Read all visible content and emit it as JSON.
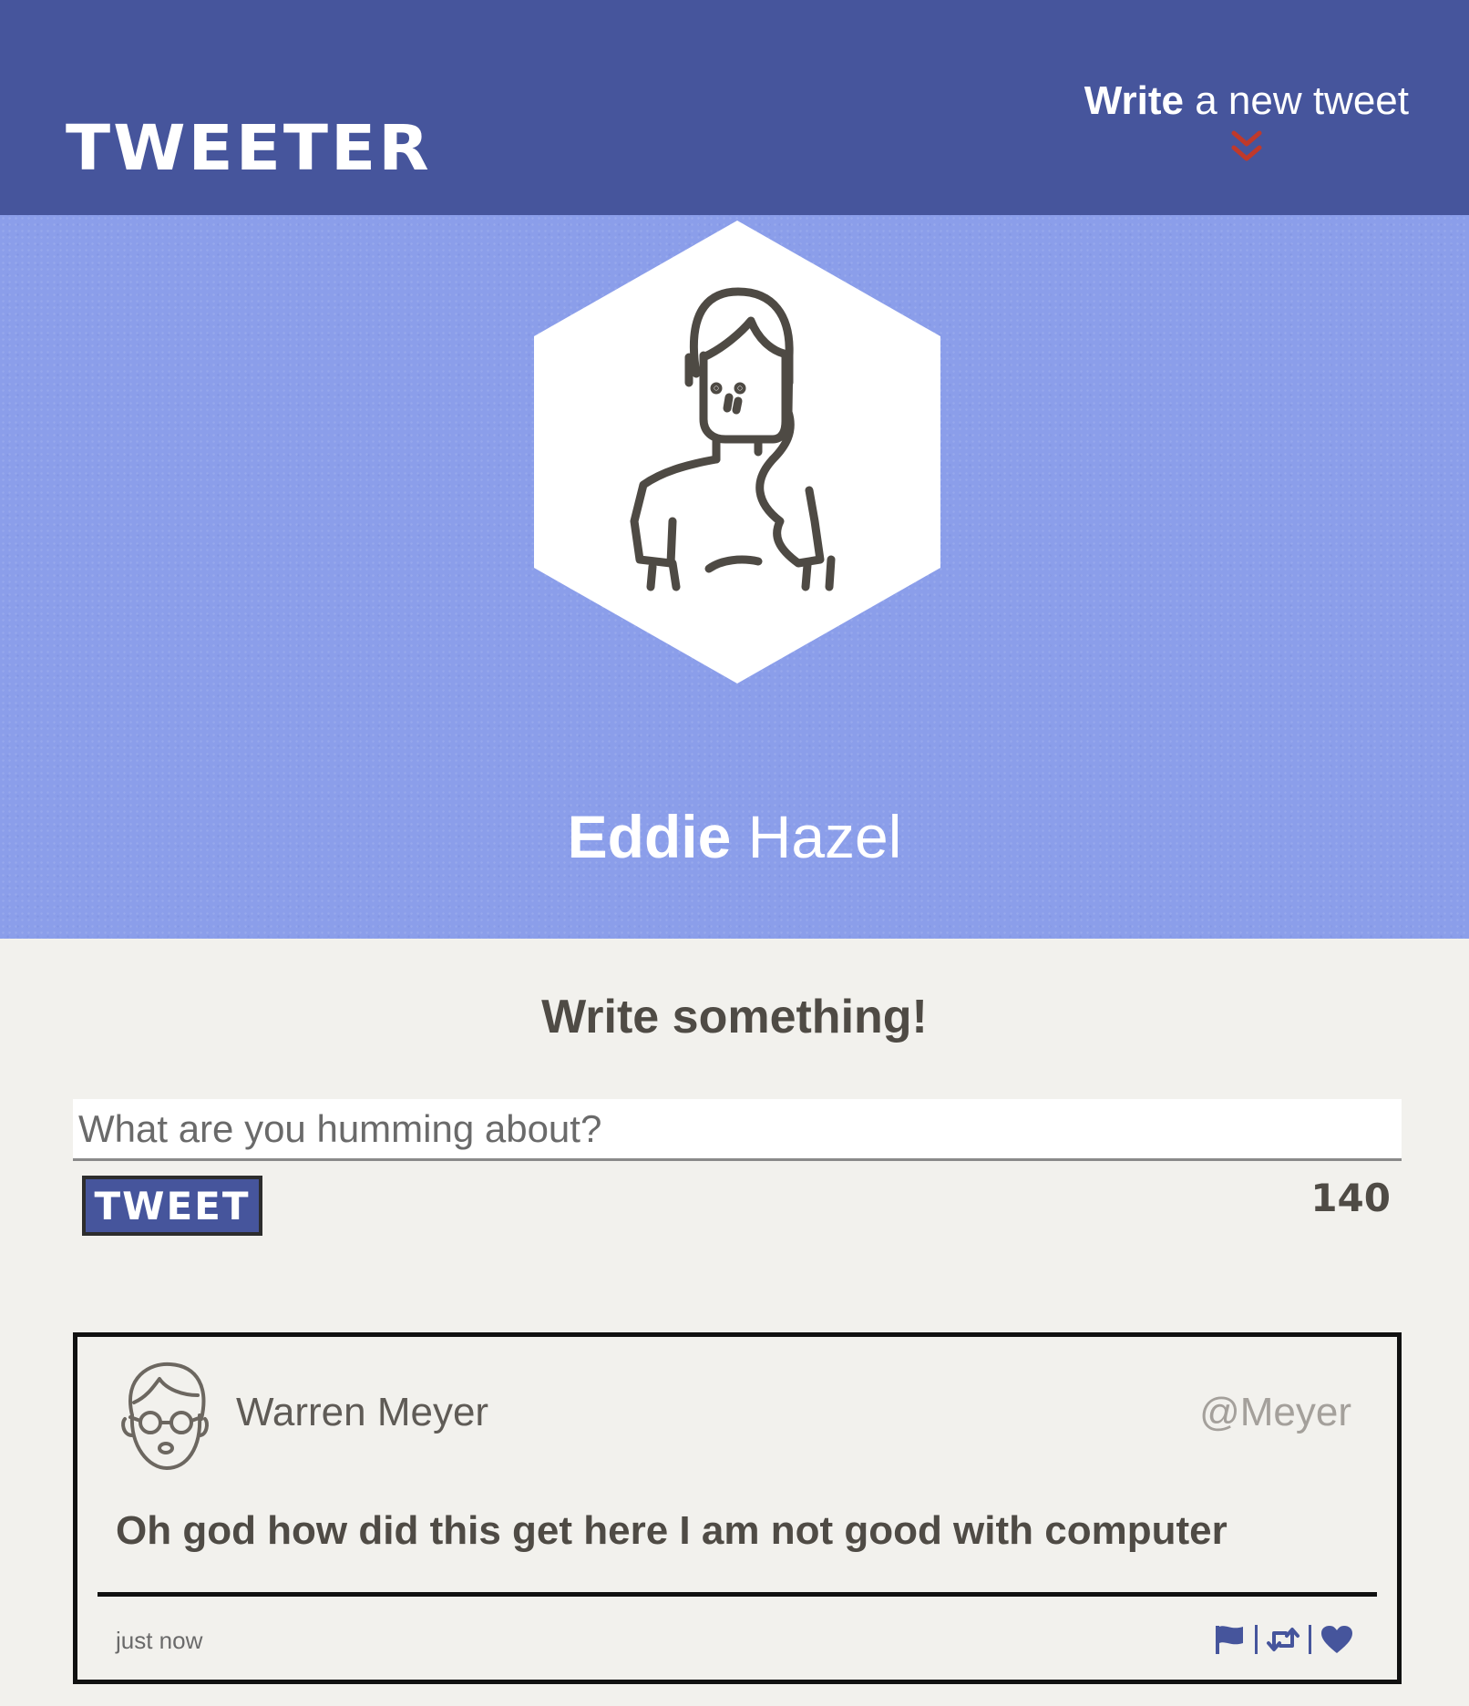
{
  "header": {
    "brand": "TWEETER",
    "compose_toggle": {
      "strong": "Write",
      "rest": " a new tweet"
    },
    "chevron_icon": "double-chevron-down-icon",
    "chevron_color": "#c0392b"
  },
  "profile": {
    "first_name": "Eddie",
    "last_name": " Hazel",
    "avatar_icon": "woman-avatar-icon"
  },
  "composer": {
    "title": "Write something!",
    "placeholder": "What are you humming about?",
    "button_label": "TWEET",
    "char_count": "140"
  },
  "tweets": [
    {
      "avatar_icon": "man-with-glasses-avatar-icon",
      "name": "Warren Meyer",
      "handle": "@Meyer",
      "body": "Oh god how did this get here I am not good with computer",
      "time": "just now",
      "actions": [
        "flag-icon",
        "retweet-icon",
        "heart-icon"
      ]
    }
  ],
  "colors": {
    "header_bg": "#46559c",
    "banner_bg": "#8b9eea",
    "page_bg": "#f2f1ed",
    "text_dark": "#4f4b45",
    "accent": "#46559c"
  }
}
